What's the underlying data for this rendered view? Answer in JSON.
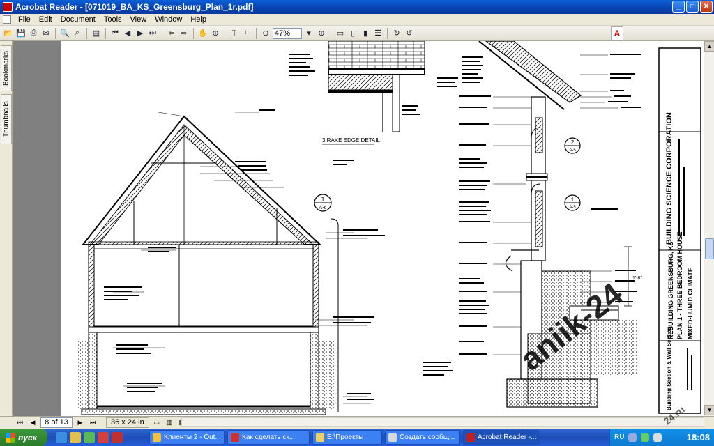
{
  "window": {
    "title": "Acrobat Reader - [071019_BA_KS_Greensburg_Plan_1r.pdf]",
    "minimize": "_",
    "maximize": "□",
    "close": "✕"
  },
  "menu": [
    "File",
    "Edit",
    "Document",
    "Tools",
    "View",
    "Window",
    "Help"
  ],
  "toolbar": {
    "zoom_value": "47%",
    "adobe_logo": "A"
  },
  "nav_tabs": [
    "Bookmarks",
    "Thumbnails"
  ],
  "drawing": {
    "titleblock_company": "BUILDING SCIENCE CORPORATION",
    "titleblock_project": "REBUILDING GREENSBURG, KS",
    "titleblock_plan": "PLAN 1 - THREE BEDROOM HOUSE",
    "titleblock_climate": "MIXED-HUMID CLIMATE",
    "titleblock_sheet": "Building Section & Wall Section",
    "detail_title": "3 RAKE EDGE DETAIL",
    "callout_1_num": "1",
    "callout_1_sheet": "A-6",
    "callout_2_num": "2",
    "callout_2_sheet": "A-5",
    "callout_3_num": "1",
    "callout_3_sheet": "A-5",
    "dimension_label": "1'-8\""
  },
  "statusbar": {
    "page_indicator": "8 of 13",
    "page_size": "36 x 24 in"
  },
  "taskbar": {
    "start_label": "пуск",
    "tasks": [
      {
        "label": "Клиенты 2 - Out...",
        "color": "#f0c040"
      },
      {
        "label": "Как сделать ск...",
        "color": "#d03030"
      },
      {
        "label": "E:\\Проекты",
        "color": "#f0d060"
      },
      {
        "label": "Создать сообщ...",
        "color": "#d8d8d8"
      },
      {
        "label": "Acrobat Reader -...",
        "color": "#c02020"
      }
    ],
    "lang": "RU",
    "clock": "18:08"
  },
  "watermark": "aniik-24",
  "watermark_small": "24.ru"
}
